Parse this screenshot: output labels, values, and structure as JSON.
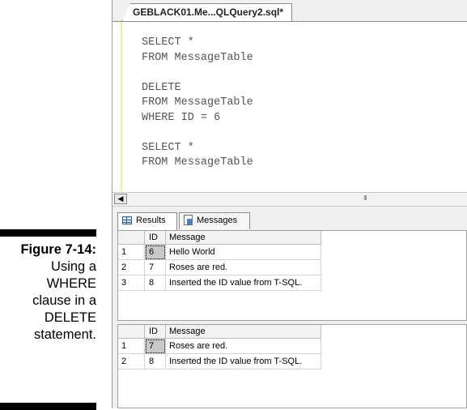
{
  "caption": {
    "figure": "Figure 7-14:",
    "lines": [
      "Using a",
      "WHERE",
      "clause in a",
      "DELETE",
      "statement."
    ]
  },
  "editor": {
    "tab_title": "GEBLACK01.Me...QLQuery2.sql*",
    "code_lines": [
      "SELECT *",
      "FROM MessageTable",
      "",
      "DELETE",
      "FROM MessageTable",
      "WHERE ID = 6",
      "",
      "SELECT *",
      "FROM MessageTable"
    ],
    "scroll_left_icon": "arrow-left-icon",
    "scroll_grip_text": "III"
  },
  "result_tabs": {
    "results_label": "Results",
    "messages_label": "Messages"
  },
  "result_sets": [
    {
      "columns": [
        "ID",
        "Message"
      ],
      "rows": [
        {
          "num": "1",
          "id": "6",
          "message": "Hello World"
        },
        {
          "num": "2",
          "id": "7",
          "message": "Roses are red."
        },
        {
          "num": "3",
          "id": "8",
          "message": "Inserted the ID value from T-SQL."
        }
      ]
    },
    {
      "columns": [
        "ID",
        "Message"
      ],
      "rows": [
        {
          "num": "1",
          "id": "7",
          "message": "Roses are red."
        },
        {
          "num": "2",
          "id": "8",
          "message": "Inserted the ID value from T-SQL."
        }
      ]
    }
  ]
}
